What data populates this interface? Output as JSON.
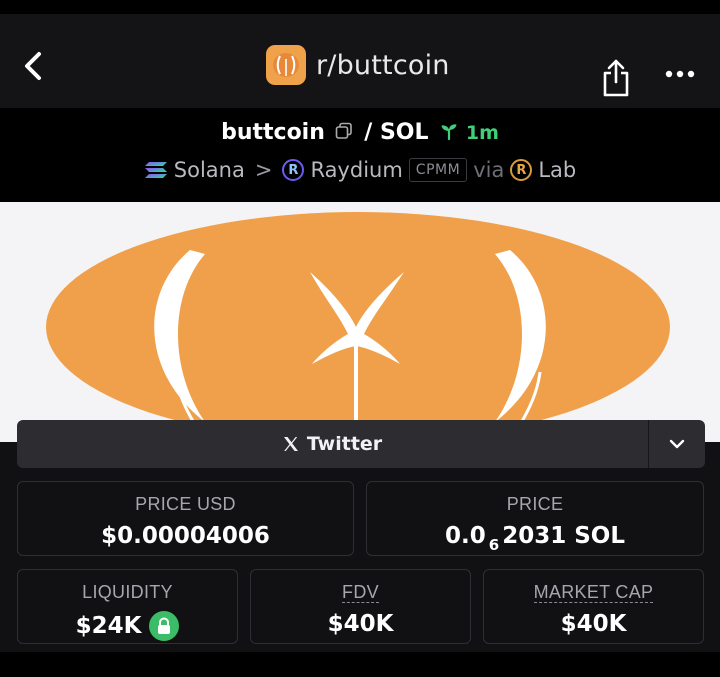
{
  "nav": {
    "title": "r/buttcoin",
    "back_icon": "chevron-left-icon",
    "share_icon": "share-icon",
    "more_icon": "more-horizontal-icon"
  },
  "pair": {
    "token": "buttcoin",
    "separator": "/",
    "quote": "SOL",
    "age": "1m",
    "chain": "Solana",
    "arrow": ">",
    "dex": "Raydium",
    "pool_type": "CPMM",
    "via": "via",
    "launchpad": "Lab"
  },
  "links": {
    "twitter_label": "Twitter"
  },
  "stats": {
    "price_usd_label": "PRICE USD",
    "price_usd": "$0.00004006",
    "price_label": "PRICE",
    "price_prefix": "0.0",
    "price_zeros": "6",
    "price_suffix": "2031 SOL",
    "liquidity_label": "LIQUIDITY",
    "liquidity": "$24K",
    "fdv_label": "FDV",
    "fdv": "$40K",
    "mcap_label": "MARKET CAP",
    "mcap": "$40K"
  },
  "colors": {
    "accent_orange": "#f0a24a",
    "age_green": "#3fd17a",
    "lock_green": "#3bbd67",
    "background": "#111114"
  }
}
